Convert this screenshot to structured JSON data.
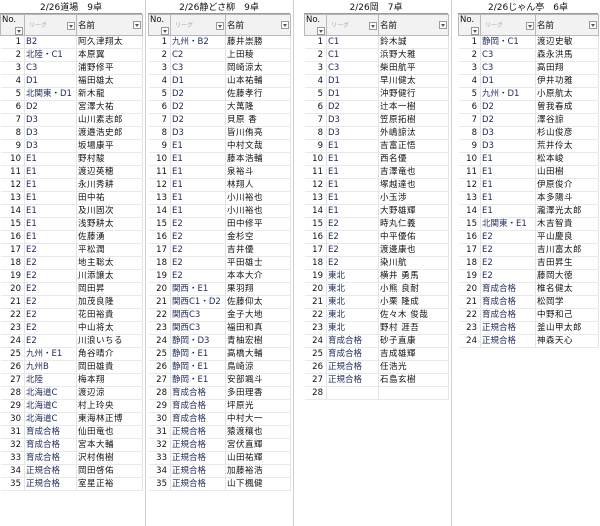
{
  "sheets": [
    {
      "title": "2/26道場　9卓",
      "col_no": "No.",
      "col_league": "リーグ",
      "col_name": "名前",
      "rows": [
        [
          "1",
          "B2",
          "阿久津翔太"
        ],
        [
          "2",
          "北陸・C1",
          "本原翼"
        ],
        [
          "3",
          "C3",
          "浦野修平"
        ],
        [
          "4",
          "D1",
          "福田雄太"
        ],
        [
          "5",
          "北関東・D1",
          "新木龍"
        ],
        [
          "6",
          "D2",
          "宮澤大祐"
        ],
        [
          "7",
          "D3",
          "山川素志郎"
        ],
        [
          "8",
          "D3",
          "渡邉浩史郎"
        ],
        [
          "9",
          "D3",
          "坂場康平"
        ],
        [
          "10",
          "E1",
          "野村駿"
        ],
        [
          "11",
          "E1",
          "渡辺英穂"
        ],
        [
          "12",
          "E1",
          "永川秀耕"
        ],
        [
          "13",
          "E1",
          "田中祐"
        ],
        [
          "14",
          "E1",
          "及川固次"
        ],
        [
          "15",
          "E1",
          "浅野耕太"
        ],
        [
          "16",
          "E1",
          "佐藤湧"
        ],
        [
          "17",
          "E2",
          "平松潤"
        ],
        [
          "18",
          "E2",
          "地主聡太"
        ],
        [
          "19",
          "E2",
          "川添譲太"
        ],
        [
          "20",
          "E2",
          "岡田昇"
        ],
        [
          "21",
          "E2",
          "加茂良隆"
        ],
        [
          "22",
          "E2",
          "花田裕貴"
        ],
        [
          "23",
          "E2",
          "中山将太"
        ],
        [
          "24",
          "E2",
          "川浪いちる"
        ],
        [
          "25",
          "九州・E1",
          "角谷晴介"
        ],
        [
          "26",
          "九州B",
          "岡田雄貴"
        ],
        [
          "27",
          "北陸",
          "梅本翔"
        ],
        [
          "28",
          "北海道C",
          "渡辺涼"
        ],
        [
          "29",
          "北海道C",
          "村上玲央"
        ],
        [
          "30",
          "北海道C",
          "東海林正博"
        ],
        [
          "31",
          "育成合格",
          "仙田竜也"
        ],
        [
          "32",
          "育成合格",
          "宮本大輔"
        ],
        [
          "33",
          "育成合格",
          "沢村侑樹"
        ],
        [
          "34",
          "正規合格",
          "岡田啓佑"
        ],
        [
          "35",
          "正規合格",
          "室星正裕"
        ]
      ]
    },
    {
      "title": "2/26静どさ柳　9卓",
      "col_no": "No.",
      "col_league": "リーグ",
      "col_name": "名前",
      "rows": [
        [
          "1",
          "九州・B2",
          "藤井崇勝"
        ],
        [
          "2",
          "C2",
          "上田稜"
        ],
        [
          "3",
          "C3",
          "岡崎涼太"
        ],
        [
          "4",
          "D1",
          "山本祐輔"
        ],
        [
          "5",
          "D2",
          "佐藤孝行"
        ],
        [
          "6",
          "D2",
          "大萬隆"
        ],
        [
          "7",
          "D2",
          "貝原 香"
        ],
        [
          "8",
          "D3",
          "皆川侑亮"
        ],
        [
          "9",
          "E1",
          "中村文哉"
        ],
        [
          "10",
          "E1",
          "藤本浩輔"
        ],
        [
          "11",
          "E1",
          "泉裕斗"
        ],
        [
          "12",
          "E1",
          "林翔人"
        ],
        [
          "13",
          "E1",
          "小川裕也"
        ],
        [
          "14",
          "E1",
          "小川裕也"
        ],
        [
          "15",
          "E2",
          "田中修平"
        ],
        [
          "16",
          "E2",
          "金杉空"
        ],
        [
          "17",
          "E2",
          "吉井優"
        ],
        [
          "18",
          "E2",
          "平田雄士"
        ],
        [
          "19",
          "E2",
          "本本大介"
        ],
        [
          "20",
          "関西・E1",
          "果羽翔"
        ],
        [
          "21",
          "関西C1・D2",
          "佐藤仰太"
        ],
        [
          "22",
          "関西C3",
          "金子大地"
        ],
        [
          "23",
          "関西C3",
          "福田和真"
        ],
        [
          "24",
          "静岡・D3",
          "青柚宏樹"
        ],
        [
          "25",
          "静岡・E1",
          "高橋大輔"
        ],
        [
          "26",
          "静岡・E1",
          "鳥崎涼"
        ],
        [
          "27",
          "静岡・E1",
          "安部颯斗"
        ],
        [
          "28",
          "育成合格",
          "多田理香"
        ],
        [
          "29",
          "育成合格",
          "坪原光"
        ],
        [
          "30",
          "育成合格",
          "中村大一"
        ],
        [
          "31",
          "正規合格",
          "猿渡穰也"
        ],
        [
          "32",
          "正規合格",
          "宮伏直輝"
        ],
        [
          "33",
          "正規合格",
          "山田祐輝"
        ],
        [
          "34",
          "正規合格",
          "加藤裕浩"
        ],
        [
          "35",
          "正規合格",
          "山下楓健"
        ]
      ]
    },
    {
      "title": "2/26岡　7卓",
      "col_no": "No.",
      "col_league": "リーグ",
      "col_name": "名前",
      "rows": [
        [
          "1",
          "C1",
          "鈴木誠"
        ],
        [
          "2",
          "C1",
          "浜野大雅"
        ],
        [
          "3",
          "C3",
          "柴田航平"
        ],
        [
          "4",
          "D1",
          "早川健太"
        ],
        [
          "5",
          "D1",
          "沖野健行"
        ],
        [
          "6",
          "D2",
          "辻本一樹"
        ],
        [
          "7",
          "D3",
          "笠原拓樹"
        ],
        [
          "8",
          "D3",
          "外嶋諒汰"
        ],
        [
          "9",
          "E1",
          "吉富正悟"
        ],
        [
          "10",
          "E1",
          "西名優"
        ],
        [
          "11",
          "E1",
          "吉澤竜也"
        ],
        [
          "12",
          "E1",
          "塚越達也"
        ],
        [
          "13",
          "E1",
          "小玉渉"
        ],
        [
          "14",
          "E1",
          "大野雄輝"
        ],
        [
          "15",
          "E2",
          "時丸仁義"
        ],
        [
          "16",
          "E2",
          "中平優佑"
        ],
        [
          "17",
          "E2",
          "渡邊康也"
        ],
        [
          "18",
          "E2",
          "染川航"
        ],
        [
          "19",
          "東北",
          "横井 勇馬"
        ],
        [
          "20",
          "東北",
          "小熊 良耐"
        ],
        [
          "21",
          "東北",
          "小栗 隆成"
        ],
        [
          "22",
          "東北",
          "佐々木 俊哉"
        ],
        [
          "23",
          "東北",
          "野村 涯吾"
        ],
        [
          "24",
          "育成合格",
          "砂子直康"
        ],
        [
          "25",
          "育成合格",
          "吉成雄輝"
        ],
        [
          "26",
          "正規合格",
          "任浩光"
        ],
        [
          "27",
          "正規合格",
          "石島玄樹"
        ],
        [
          "28",
          "",
          ""
        ]
      ]
    },
    {
      "title": "2/26じゃん亭　6卓",
      "col_no": "No.",
      "col_league": "リーグ",
      "col_name": "名前",
      "rows": [
        [
          "1",
          "静岡・C1",
          "渡辺史敏"
        ],
        [
          "2",
          "C3",
          "森永洪馬"
        ],
        [
          "3",
          "C3",
          "高田翔"
        ],
        [
          "4",
          "D1",
          "伊井功雅"
        ],
        [
          "5",
          "九州・D1",
          "小原航太"
        ],
        [
          "6",
          "D2",
          "曽我春成"
        ],
        [
          "7",
          "D2",
          "澤谷諒"
        ],
        [
          "8",
          "D3",
          "杉山俊彦"
        ],
        [
          "9",
          "D3",
          "荒井伶太"
        ],
        [
          "10",
          "E1",
          "松本峻"
        ],
        [
          "11",
          "E1",
          "山田樹"
        ],
        [
          "12",
          "E1",
          "伊原俊介"
        ],
        [
          "13",
          "E1",
          "本多陽斗"
        ],
        [
          "14",
          "E1",
          "瀧澤光太郎"
        ],
        [
          "15",
          "北関東・E1",
          "木吉智貴"
        ],
        [
          "16",
          "E2",
          "平山慶良"
        ],
        [
          "17",
          "E2",
          "吉川富太郎"
        ],
        [
          "18",
          "E2",
          "吉田昇生"
        ],
        [
          "19",
          "E2",
          "藤岡大徳"
        ],
        [
          "20",
          "育成合格",
          "椎名健太"
        ],
        [
          "21",
          "育成合格",
          "松岡学"
        ],
        [
          "22",
          "育成合格",
          "中野和己"
        ],
        [
          "23",
          "正規合格",
          "釜山甲太郎"
        ],
        [
          "24",
          "正規合格",
          "神森天心"
        ]
      ]
    }
  ]
}
